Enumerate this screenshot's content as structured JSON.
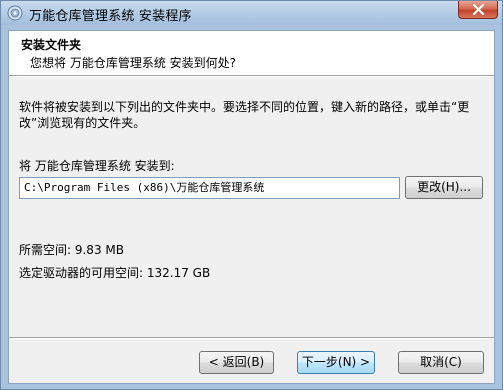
{
  "window": {
    "title": "万能仓库管理系统 安装程序"
  },
  "header": {
    "title": "安装文件夹",
    "subtitle": "您想将 万能仓库管理系统 安装到何处?"
  },
  "body": {
    "description": "软件将被安装到以下列出的文件夹中。要选择不同的位置，键入新的路径，或单击“更改”浏览现有的文件夹。",
    "install_label": "将 万能仓库管理系统 安装到:",
    "install_path": "C:\\Program Files (x86)\\万能仓库管理系统",
    "change_button": "更改(H)...",
    "required_space": "所需空间: 9.83 MB",
    "free_space": "选定驱动器的可用空间: 132.17 GB"
  },
  "footer": {
    "back_button": "< 返回(B)",
    "next_button": "下一步(N) >",
    "cancel_button": "取消(C)"
  },
  "colors": {
    "frame": "#a9c2dd",
    "close_button": "#c0442a",
    "dialog_bg": "#f0f0f0"
  },
  "icons": {
    "app": "installer-cd-icon",
    "close": "close-icon"
  }
}
